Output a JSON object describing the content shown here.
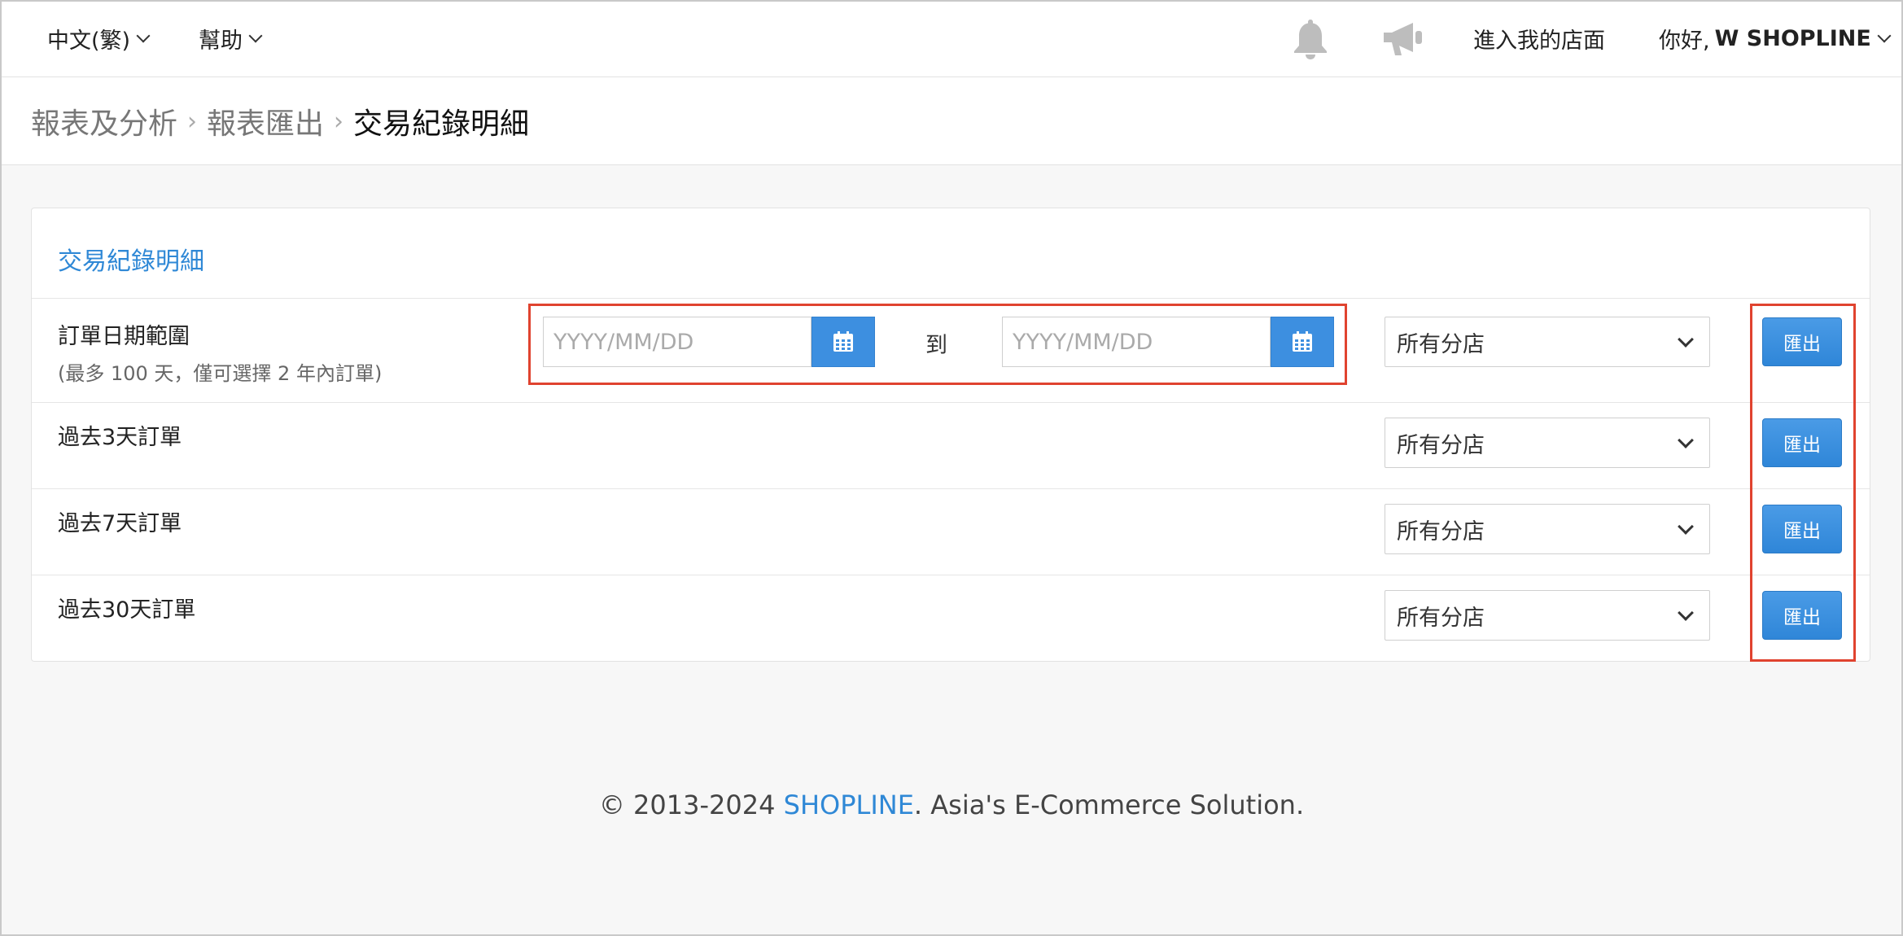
{
  "nav": {
    "language": "中文(繁)",
    "help": "幫助",
    "enter_store": "進入我的店面",
    "greeting": "你好,",
    "user_name": "W SHOPLINE"
  },
  "breadcrumb": {
    "items": [
      "報表及分析",
      "報表匯出"
    ],
    "current": "交易紀錄明細"
  },
  "panel": {
    "title": "交易紀錄明細",
    "rows": [
      {
        "label": "訂單日期範圍",
        "sublabel": "(最多 100 天，僅可選擇 2 年內訂單)",
        "start_placeholder": "YYYY/MM/DD",
        "to": "到",
        "end_placeholder": "YYYY/MM/DD",
        "store": "所有分店",
        "export": "匯出"
      },
      {
        "label": "過去3天訂單",
        "store": "所有分店",
        "export": "匯出"
      },
      {
        "label": "過去7天訂單",
        "store": "所有分店",
        "export": "匯出"
      },
      {
        "label": "過去30天訂單",
        "store": "所有分店",
        "export": "匯出"
      }
    ]
  },
  "footer": {
    "prefix": "© 2013-2024 ",
    "brand": "SHOPLINE",
    "suffix": ". Asia's E-Commerce Solution."
  },
  "colors": {
    "accent": "#2f88d6",
    "button": "#3d8fe0",
    "highlight": "#e0432f"
  },
  "icons": [
    "chevron-down-icon",
    "bell-icon",
    "megaphone-icon",
    "calendar-icon"
  ]
}
